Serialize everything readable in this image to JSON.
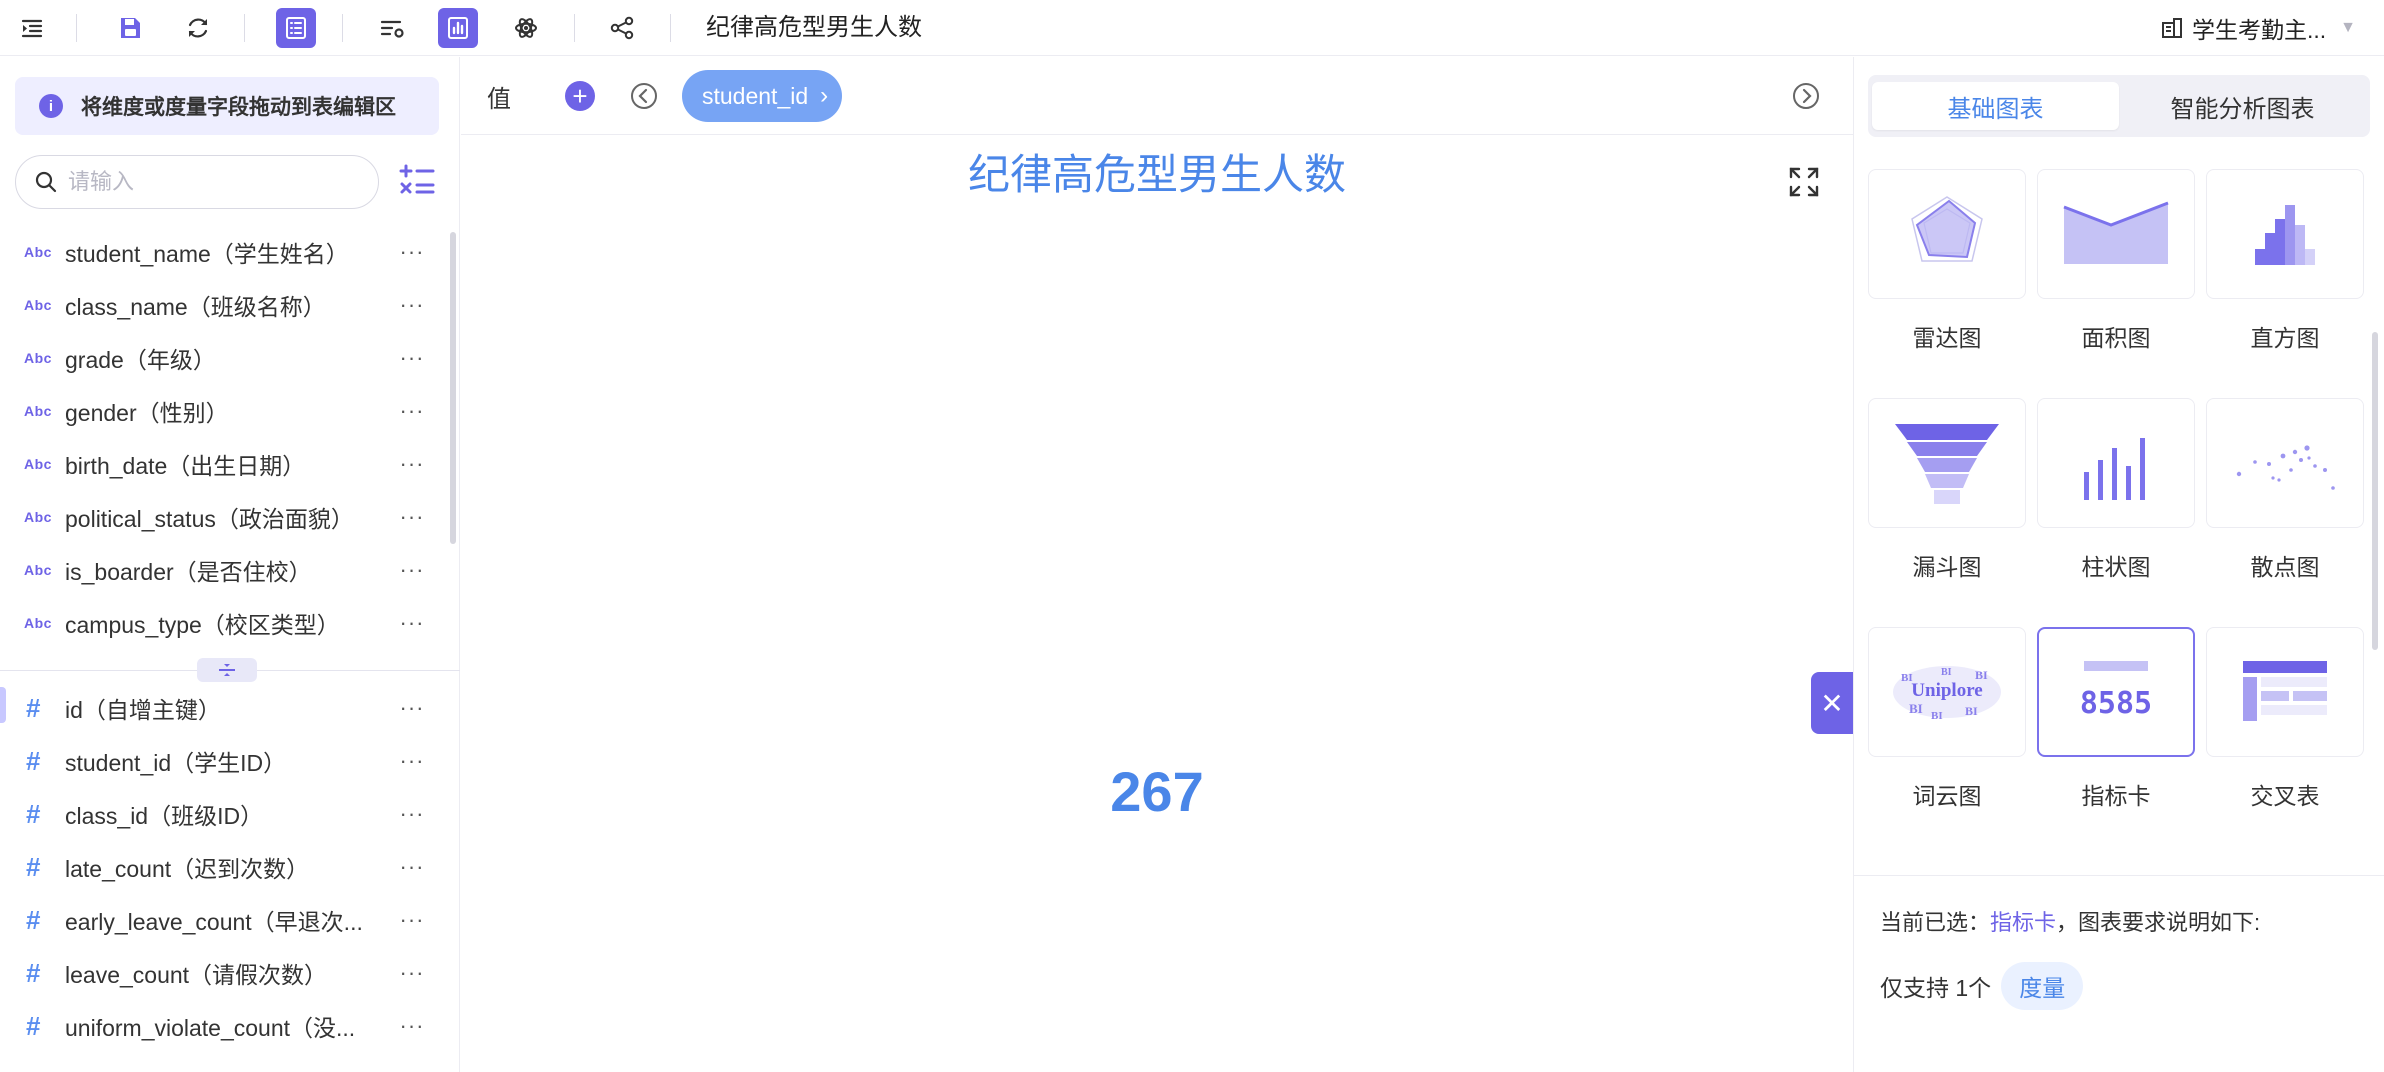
{
  "toolbar": {
    "report_title": "纪律高危型男生人数",
    "dataset_name": "学生考勤主..."
  },
  "left_panel": {
    "hint": "将维度或度量字段拖动到表编辑区",
    "search_placeholder": "请输入",
    "dimension_type_label": "Abc",
    "measure_type_label": "#",
    "more_label": "···",
    "dimensions": [
      {
        "label": "student_name（学生姓名）"
      },
      {
        "label": "class_name（班级名称）"
      },
      {
        "label": "grade（年级）"
      },
      {
        "label": "gender（性别）"
      },
      {
        "label": "birth_date（出生日期）"
      },
      {
        "label": "political_status（政治面貌）"
      },
      {
        "label": "is_boarder（是否住校）"
      },
      {
        "label": "campus_type（校区类型）"
      }
    ],
    "measures": [
      {
        "label": "id（自增主键）"
      },
      {
        "label": "student_id（学生ID）"
      },
      {
        "label": "class_id（班级ID）"
      },
      {
        "label": "late_count（迟到次数）"
      },
      {
        "label": "early_leave_count（早退次..."
      },
      {
        "label": "leave_count（请假次数）"
      },
      {
        "label": "uniform_violate_count（没..."
      }
    ]
  },
  "center": {
    "shelf_label": "值",
    "pill_label": "student_id",
    "chart_title": "纪律高危型男生人数",
    "kpi_value": "267"
  },
  "right_panel": {
    "tabs": [
      {
        "label": "基础图表",
        "active": true
      },
      {
        "label": "智能分析图表",
        "active": false
      }
    ],
    "chart_types": [
      {
        "label": "雷达图",
        "icon": "radar-chart-icon"
      },
      {
        "label": "面积图",
        "icon": "area-chart-icon"
      },
      {
        "label": "直方图",
        "icon": "histogram-icon"
      },
      {
        "label": "漏斗图",
        "icon": "funnel-chart-icon"
      },
      {
        "label": "柱状图",
        "icon": "bar-chart-icon"
      },
      {
        "label": "散点图",
        "icon": "scatter-chart-icon"
      },
      {
        "label": "词云图",
        "icon": "word-cloud-icon"
      },
      {
        "label": "指标卡",
        "icon": "kpi-card-icon",
        "selected": true
      },
      {
        "label": "交叉表",
        "icon": "cross-table-icon"
      }
    ],
    "word_cloud_text": "Uniplore",
    "word_cloud_small": "BI",
    "kpi_card_sample": "8585",
    "requirement": {
      "prefix": "当前已选：",
      "selected": "指标卡",
      "suffix": "，图表要求说明如下:",
      "support_prefix": "仅支持 1个",
      "support_tag": "度量"
    }
  },
  "colors": {
    "accent": "#6e63e6",
    "blue": "#4a86e8",
    "pill": "#77a4f4"
  }
}
